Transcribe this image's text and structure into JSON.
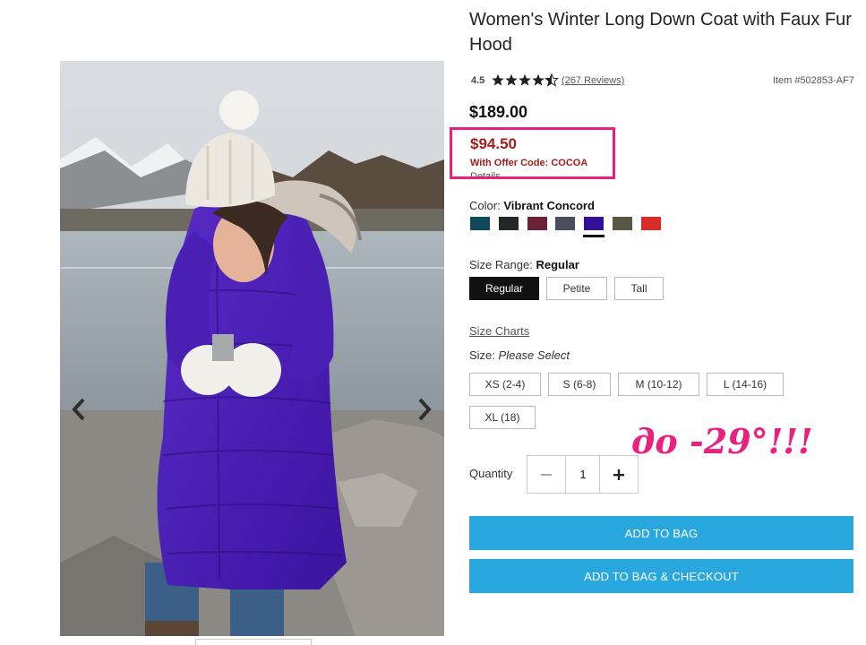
{
  "product": {
    "title": "Women's Winter Long Down Coat with Faux Fur Hood",
    "rating_value": "4.5",
    "rating": 4.5,
    "stars_icon": "star-rating-icon",
    "reviews_link": "(267 Reviews)",
    "item_number": "Item #502853-AF7",
    "price": "$189.00",
    "sale_price": "$94.50",
    "offer_text": "With Offer Code: COCOA",
    "details_link": "Details"
  },
  "color": {
    "label": "Color:",
    "selected_name": "Vibrant Concord",
    "swatches": [
      "#0f4a5a",
      "#252628",
      "#6c2236",
      "#4a4e5c",
      "#35109a",
      "#5a5644",
      "#d92b2a"
    ],
    "selected_index": 4
  },
  "size_range": {
    "label": "Size Range:",
    "selected": "Regular",
    "options": [
      "Regular",
      "Petite",
      "Tall"
    ]
  },
  "size": {
    "charts_link": "Size Charts",
    "label": "Size:",
    "placeholder": "Please Select",
    "options": [
      "XS (2-4)",
      "S (6-8)",
      "M (10-12)",
      "L (14-16)",
      "XL (18)"
    ]
  },
  "quantity": {
    "label": "Quantity",
    "value": "1",
    "minus_icon": "minus-icon",
    "plus_icon": "plus-icon"
  },
  "actions": {
    "add_to_bag": "ADD TO BAG",
    "add_and_checkout": "ADD TO BAG & CHECKOUT"
  },
  "annotation": {
    "text": "до -29°!!!",
    "color": "#e8217f"
  },
  "gallery": {
    "prev_icon": "chevron-left-icon",
    "next_icon": "chevron-right-icon",
    "image_subject": "woman in purple down coat with white knit hat holding a cup"
  }
}
